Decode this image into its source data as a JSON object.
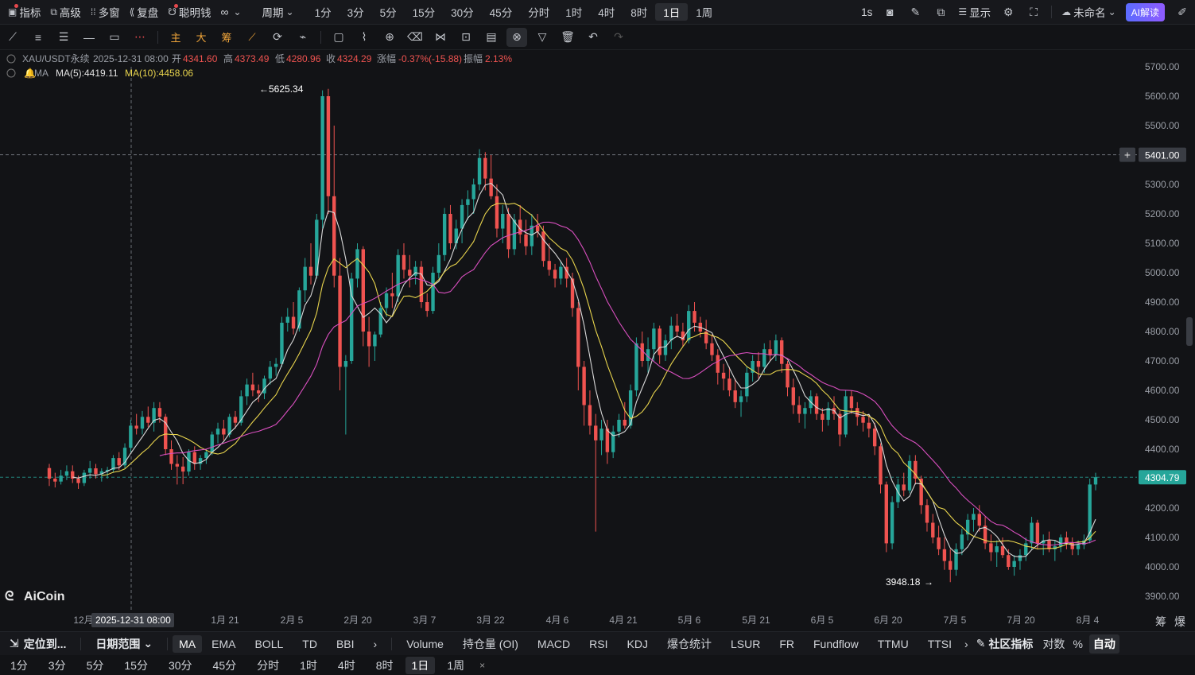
{
  "topbar": {
    "left": [
      {
        "label": "指标",
        "icon": "indicator-icon",
        "dot": true
      },
      {
        "label": "高级",
        "icon": "advanced-icon",
        "dot": false
      },
      {
        "label": "多窗",
        "icon": "multi-window-icon",
        "dot": false
      },
      {
        "label": "复盘",
        "icon": "replay-icon",
        "dot": false
      },
      {
        "label": "聪明钱",
        "icon": "smart-money-icon",
        "dot": true
      }
    ],
    "oo_label": "∞",
    "period_label": "周期",
    "periods": [
      "1分",
      "3分",
      "5分",
      "15分",
      "30分",
      "45分",
      "分时",
      "1时",
      "4时",
      "8时",
      "1日",
      "1周"
    ],
    "active_period": "1日",
    "interval_label": "1s",
    "display_label": "显示",
    "layout_name": "未命名",
    "ai_label": "AI解读"
  },
  "chart_header": {
    "symbol": "XAU/USDT永续",
    "date": "2025-12-31 08:00",
    "open_label": "开",
    "open": "4341.60",
    "high_label": "高",
    "high": "4373.49",
    "low_label": "低",
    "low": "4280.96",
    "close_label": "收",
    "close": "4324.29",
    "change_label": "涨幅",
    "change": "-0.37%(-15.88)",
    "amplitude_label": "振幅",
    "amplitude": "2.13%",
    "ma_label": "MA",
    "ma5": "MA(5):4419.11",
    "ma10": "MA(10):4458.06"
  },
  "price_axis": [
    "5700.00",
    "5600.00",
    "5500.00",
    "5400.00",
    "5300.00",
    "5200.00",
    "5100.00",
    "5000.00",
    "4900.00",
    "4800.00",
    "4700.00",
    "4600.00",
    "4500.00",
    "4400.00",
    "4300.00",
    "4200.00",
    "4100.00",
    "4000.00",
    "3900.00"
  ],
  "crosshair_price": "5401.00",
  "last_price": "4304.79",
  "high_annotation": "5625.34",
  "low_annotation": "3948.18",
  "date_axis": [
    "12月",
    "1月 21",
    "2月 5",
    "2月 20",
    "3月 7",
    "3月 22",
    "4月 6",
    "4月 21",
    "5月 6",
    "5月 21",
    "6月 5",
    "6月 20",
    "7月 5",
    "7月 20",
    "8月 4"
  ],
  "crosshair_date": "2025-12-31 08:00",
  "watermark": "AiCoin",
  "corner_labels": [
    "筹",
    "爆"
  ],
  "bottom_indicators": {
    "locate": "定位到...",
    "date_range": "日期范围",
    "main": [
      "MA",
      "EMA",
      "BOLL",
      "TD",
      "BBI"
    ],
    "active_main": "MA",
    "sub": [
      "Volume",
      "持仓量 (OI)",
      "MACD",
      "RSI",
      "KDJ",
      "爆仓统计",
      "LSUR",
      "FR",
      "Fundflow",
      "TTMU",
      "TTSI"
    ],
    "community": "社区指标",
    "log_label": "对数",
    "pct_label": "%",
    "auto_label": "自动"
  },
  "bottom_periods": [
    "1分",
    "3分",
    "5分",
    "15分",
    "30分",
    "45分",
    "分时",
    "1时",
    "4时",
    "8时",
    "1日",
    "1周"
  ],
  "active_bottom_period": "1日",
  "colors": {
    "up": "#26a69a",
    "down": "#ef5350",
    "ma5": "#d9d9d9",
    "ma10": "#e8d44d",
    "ma20": "#d94fbf",
    "bg": "#121316"
  },
  "chart_data": {
    "type": "candlestick",
    "symbol": "XAU/USDT永续",
    "ylim": [
      3880,
      5750
    ],
    "ohlc": [
      [
        4336,
        4350,
        4275,
        4300
      ],
      [
        4300,
        4320,
        4270,
        4290
      ],
      [
        4290,
        4330,
        4280,
        4310
      ],
      [
        4310,
        4345,
        4295,
        4325
      ],
      [
        4325,
        4345,
        4285,
        4300
      ],
      [
        4300,
        4310,
        4265,
        4285
      ],
      [
        4285,
        4330,
        4275,
        4320
      ],
      [
        4320,
        4360,
        4300,
        4335
      ],
      [
        4335,
        4350,
        4300,
        4315
      ],
      [
        4315,
        4335,
        4290,
        4325
      ],
      [
        4325,
        4340,
        4300,
        4330
      ],
      [
        4330,
        4380,
        4320,
        4370
      ],
      [
        4370,
        4390,
        4330,
        4345
      ],
      [
        4345,
        4420,
        4335,
        4405
      ],
      [
        4405,
        4500,
        4390,
        4480
      ],
      [
        4480,
        4520,
        4450,
        4470
      ],
      [
        4470,
        4530,
        4450,
        4510
      ],
      [
        4510,
        4545,
        4475,
        4490
      ],
      [
        4490,
        4560,
        4460,
        4540
      ],
      [
        4540,
        4560,
        4490,
        4510
      ],
      [
        4510,
        4520,
        4380,
        4400
      ],
      [
        4400,
        4430,
        4330,
        4350
      ],
      [
        4350,
        4380,
        4280,
        4341
      ],
      [
        4341,
        4373,
        4281,
        4324
      ],
      [
        4324,
        4400,
        4310,
        4390
      ],
      [
        4390,
        4410,
        4330,
        4350
      ],
      [
        4350,
        4380,
        4330,
        4370
      ],
      [
        4370,
        4400,
        4350,
        4390
      ],
      [
        4390,
        4460,
        4380,
        4450
      ],
      [
        4450,
        4490,
        4420,
        4470
      ],
      [
        4470,
        4500,
        4430,
        4450
      ],
      [
        4450,
        4520,
        4440,
        4510
      ],
      [
        4510,
        4530,
        4470,
        4490
      ],
      [
        4490,
        4600,
        4480,
        4580
      ],
      [
        4580,
        4640,
        4550,
        4620
      ],
      [
        4620,
        4660,
        4580,
        4600
      ],
      [
        4600,
        4620,
        4560,
        4590
      ],
      [
        4590,
        4650,
        4570,
        4640
      ],
      [
        4640,
        4700,
        4620,
        4680
      ],
      [
        4680,
        4710,
        4650,
        4690
      ],
      [
        4690,
        4850,
        4680,
        4830
      ],
      [
        4830,
        4880,
        4800,
        4850
      ],
      [
        4850,
        4900,
        4790,
        4810
      ],
      [
        4810,
        4950,
        4800,
        4940
      ],
      [
        4940,
        5050,
        4900,
        5020
      ],
      [
        5020,
        5100,
        4960,
        4990
      ],
      [
        4990,
        5200,
        4980,
        5180
      ],
      [
        5180,
        5620,
        5150,
        5600
      ],
      [
        5600,
        5625,
        5200,
        5260
      ],
      [
        5260,
        5500,
        4950,
        4990
      ],
      [
        4990,
        5050,
        4600,
        4680
      ],
      [
        4680,
        4720,
        4450,
        4700
      ],
      [
        4700,
        5000,
        4690,
        4980
      ],
      [
        4980,
        5100,
        4950,
        5080
      ],
      [
        5080,
        5090,
        4750,
        4800
      ],
      [
        4800,
        4850,
        4680,
        4750
      ],
      [
        4750,
        4800,
        4700,
        4790
      ],
      [
        4790,
        4900,
        4780,
        4880
      ],
      [
        4880,
        4950,
        4850,
        4930
      ],
      [
        4930,
        5000,
        4880,
        4920
      ],
      [
        4920,
        5080,
        4900,
        5060
      ],
      [
        5060,
        5100,
        4980,
        5010
      ],
      [
        5010,
        5060,
        4950,
        4990
      ],
      [
        4990,
        5040,
        4960,
        5020
      ],
      [
        5020,
        5040,
        4880,
        4900
      ],
      [
        4900,
        4930,
        4850,
        4870
      ],
      [
        4870,
        5020,
        4860,
        5000
      ],
      [
        5000,
        5100,
        4980,
        5060
      ],
      [
        5060,
        5220,
        5040,
        5200
      ],
      [
        5200,
        5230,
        5080,
        5100
      ],
      [
        5100,
        5180,
        5080,
        5150
      ],
      [
        5150,
        5250,
        5100,
        5230
      ],
      [
        5230,
        5280,
        5180,
        5250
      ],
      [
        5250,
        5320,
        5200,
        5300
      ],
      [
        5300,
        5420,
        5280,
        5390
      ],
      [
        5390,
        5410,
        5280,
        5320
      ],
      [
        5320,
        5400,
        5250,
        5260
      ],
      [
        5260,
        5300,
        5120,
        5150
      ],
      [
        5150,
        5230,
        5100,
        5200
      ],
      [
        5200,
        5220,
        5050,
        5080
      ],
      [
        5080,
        5200,
        5060,
        5180
      ],
      [
        5180,
        5230,
        5100,
        5130
      ],
      [
        5130,
        5180,
        5060,
        5090
      ],
      [
        5090,
        5200,
        5060,
        5160
      ],
      [
        5160,
        5200,
        5120,
        5140
      ],
      [
        5140,
        5160,
        5020,
        5040
      ],
      [
        5040,
        5100,
        4990,
        5010
      ],
      [
        5010,
        5030,
        4950,
        4980
      ],
      [
        4980,
        5040,
        4960,
        5020
      ],
      [
        5020,
        5050,
        4950,
        4980
      ],
      [
        4980,
        5000,
        4850,
        4880
      ],
      [
        4880,
        4900,
        4600,
        4680
      ],
      [
        4680,
        4700,
        4480,
        4550
      ],
      [
        4550,
        4600,
        4450,
        4480
      ],
      [
        4480,
        4520,
        4120,
        4430
      ],
      [
        4430,
        4500,
        4380,
        4470
      ],
      [
        4470,
        4500,
        4350,
        4390
      ],
      [
        4390,
        4480,
        4370,
        4460
      ],
      [
        4460,
        4520,
        4440,
        4500
      ],
      [
        4500,
        4560,
        4470,
        4480
      ],
      [
        4480,
        4620,
        4470,
        4600
      ],
      [
        4600,
        4780,
        4580,
        4760
      ],
      [
        4760,
        4800,
        4680,
        4700
      ],
      [
        4700,
        4780,
        4660,
        4740
      ],
      [
        4740,
        4830,
        4700,
        4810
      ],
      [
        4810,
        4820,
        4690,
        4720
      ],
      [
        4720,
        4790,
        4700,
        4770
      ],
      [
        4770,
        4850,
        4740,
        4820
      ],
      [
        4820,
        4860,
        4780,
        4800
      ],
      [
        4800,
        4830,
        4750,
        4770
      ],
      [
        4770,
        4890,
        4760,
        4870
      ],
      [
        4870,
        4900,
        4800,
        4830
      ],
      [
        4830,
        4850,
        4780,
        4800
      ],
      [
        4800,
        4840,
        4740,
        4760
      ],
      [
        4760,
        4790,
        4700,
        4720
      ],
      [
        4720,
        4740,
        4620,
        4660
      ],
      [
        4660,
        4690,
        4600,
        4640
      ],
      [
        4640,
        4680,
        4580,
        4600
      ],
      [
        4600,
        4640,
        4540,
        4560
      ],
      [
        4560,
        4600,
        4510,
        4580
      ],
      [
        4580,
        4680,
        4560,
        4660
      ],
      [
        4660,
        4720,
        4630,
        4700
      ],
      [
        4700,
        4730,
        4640,
        4680
      ],
      [
        4680,
        4760,
        4660,
        4740
      ],
      [
        4740,
        4770,
        4700,
        4720
      ],
      [
        4720,
        4790,
        4700,
        4770
      ],
      [
        4770,
        4780,
        4660,
        4690
      ],
      [
        4690,
        4700,
        4580,
        4610
      ],
      [
        4610,
        4640,
        4520,
        4550
      ],
      [
        4550,
        4580,
        4490,
        4520
      ],
      [
        4520,
        4560,
        4470,
        4540
      ],
      [
        4540,
        4600,
        4520,
        4580
      ],
      [
        4580,
        4590,
        4500,
        4520
      ],
      [
        4520,
        4540,
        4460,
        4500
      ],
      [
        4500,
        4560,
        4480,
        4540
      ],
      [
        4540,
        4580,
        4500,
        4520
      ],
      [
        4520,
        4530,
        4410,
        4450
      ],
      [
        4450,
        4600,
        4440,
        4580
      ],
      [
        4580,
        4600,
        4520,
        4540
      ],
      [
        4540,
        4560,
        4480,
        4510
      ],
      [
        4510,
        4530,
        4460,
        4490
      ],
      [
        4490,
        4520,
        4440,
        4470
      ],
      [
        4470,
        4490,
        4380,
        4410
      ],
      [
        4410,
        4420,
        4250,
        4280
      ],
      [
        4280,
        4290,
        4050,
        4080
      ],
      [
        4080,
        4240,
        4060,
        4220
      ],
      [
        4220,
        4300,
        4200,
        4280
      ],
      [
        4280,
        4320,
        4240,
        4260
      ],
      [
        4260,
        4380,
        4250,
        4360
      ],
      [
        4360,
        4380,
        4280,
        4300
      ],
      [
        4300,
        4310,
        4180,
        4210
      ],
      [
        4210,
        4230,
        4120,
        4150
      ],
      [
        4150,
        4180,
        4080,
        4100
      ],
      [
        4100,
        4140,
        4040,
        4060
      ],
      [
        4060,
        4100,
        3990,
        4020
      ],
      [
        4020,
        4060,
        3948,
        3990
      ],
      [
        3990,
        4080,
        3970,
        4060
      ],
      [
        4060,
        4130,
        4040,
        4110
      ],
      [
        4110,
        4180,
        4090,
        4160
      ],
      [
        4160,
        4200,
        4120,
        4180
      ],
      [
        4180,
        4210,
        4120,
        4140
      ],
      [
        4140,
        4170,
        4060,
        4080
      ],
      [
        4080,
        4110,
        4020,
        4050
      ],
      [
        4050,
        4090,
        4000,
        4070
      ],
      [
        4070,
        4100,
        4030,
        4040
      ],
      [
        4040,
        4060,
        3990,
        4000
      ],
      [
        4000,
        4040,
        3970,
        4020
      ],
      [
        4020,
        4060,
        3990,
        4040
      ],
      [
        4040,
        4100,
        4020,
        4080
      ],
      [
        4080,
        4170,
        4060,
        4150
      ],
      [
        4150,
        4160,
        4060,
        4080
      ],
      [
        4080,
        4110,
        4040,
        4090
      ],
      [
        4090,
        4120,
        4050,
        4060
      ],
      [
        4060,
        4090,
        4020,
        4070
      ],
      [
        4070,
        4110,
        4050,
        4100
      ],
      [
        4100,
        4120,
        4060,
        4080
      ],
      [
        4080,
        4100,
        4040,
        4060
      ],
      [
        4060,
        4090,
        4040,
        4075
      ],
      [
        4075,
        4110,
        4060,
        4090
      ],
      [
        4090,
        4300,
        4080,
        4280
      ],
      [
        4280,
        4320,
        4260,
        4305
      ]
    ],
    "start_date": "2025-12-10",
    "interval": "1d"
  }
}
